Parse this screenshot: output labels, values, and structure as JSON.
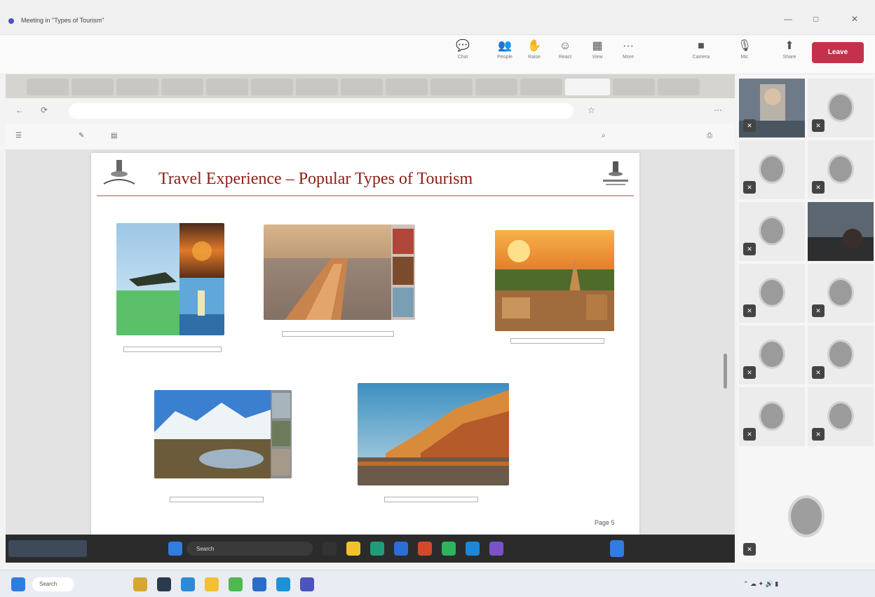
{
  "window": {
    "title": "Meeting in \"Types of Tourism\"",
    "controls": [
      "—",
      "□",
      "✕"
    ]
  },
  "meeting": {
    "timer": "",
    "buttons": [
      {
        "icon": "chat-icon",
        "glyph": "💬",
        "label": "Chat"
      },
      {
        "icon": "people-icon",
        "glyph": "👥",
        "label": "People"
      },
      {
        "icon": "raise-hand-icon",
        "glyph": "✋",
        "label": "Raise"
      },
      {
        "icon": "react-icon",
        "glyph": "☺",
        "label": "React"
      },
      {
        "icon": "view-icon",
        "glyph": "▦",
        "label": "View"
      },
      {
        "icon": "more-icon",
        "glyph": "···",
        "label": "More"
      },
      {
        "icon": "camera-icon",
        "glyph": "■",
        "label": "Camera"
      },
      {
        "icon": "mic-icon",
        "glyph": "🎙",
        "label": "Mic"
      },
      {
        "icon": "share-icon",
        "glyph": "⬆",
        "label": "Share"
      }
    ],
    "leave_label": "Leave"
  },
  "browser": {
    "tabs": [
      "",
      "",
      "",
      "",
      "",
      "",
      "",
      "",
      "",
      "",
      "",
      "",
      "",
      "",
      ""
    ],
    "url": "",
    "pdf_toolbar": {
      "zoom": "",
      "page_of": ""
    }
  },
  "slide": {
    "title": "Travel Experience – Popular Types of Tourism",
    "captions": [
      {
        "line1": "",
        "line2": ""
      },
      {
        "line1": "",
        "line2": ""
      },
      {
        "line1": "",
        "line2": ""
      },
      {
        "line1": "",
        "line2": ""
      },
      {
        "line1": "",
        "line2": ""
      }
    ],
    "page_label": "Page 5"
  },
  "presenter_taskbar": {
    "name": "",
    "search": "Search"
  },
  "participants": {
    "pager": ""
  },
  "taskbar": {
    "search": "Search",
    "time": "",
    "date": ""
  },
  "colors": {
    "accent": "#4b53bc",
    "leave": "#c4314b",
    "slide_title": "#8b1e14",
    "caption_text": "#b12a1f"
  }
}
